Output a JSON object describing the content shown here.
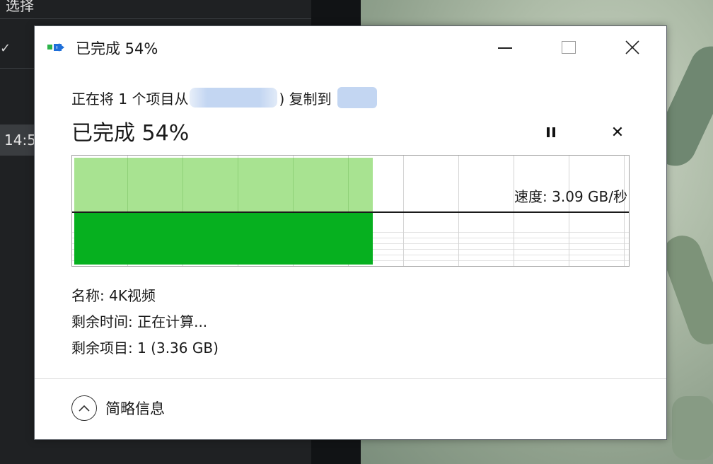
{
  "background": {
    "left_app": {
      "top_text": "选择",
      "check_glyph": "✓",
      "time_text": "14:5"
    }
  },
  "dialog": {
    "title": "已完成 54%",
    "window_controls": {
      "minimize_icon": "minimize-icon",
      "maximize_icon": "maximize-icon",
      "close_icon": "close-icon"
    },
    "description": {
      "prefix": "正在将 1 个项目从",
      "source": "",
      "mid": ") 复制到",
      "destination": ""
    },
    "status": "已完成 54%",
    "progress": 0.54,
    "graph": {
      "speed_label": "速度: 3.09 GB/秒",
      "colors": {
        "history": "#a8e391",
        "fill": "#06b01f"
      }
    },
    "details": {
      "name": "名称: 4K视频",
      "time_remaining": "剩余时间: 正在计算...",
      "items_remaining": "剩余项目: 1 (3.36 GB)"
    },
    "footer": {
      "toggle_label": "简略信息",
      "toggle_icon": "chevron-up-icon"
    }
  }
}
